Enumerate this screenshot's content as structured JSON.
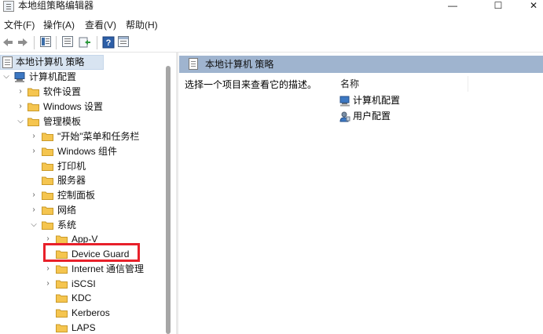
{
  "window": {
    "title": "本地组策略编辑器",
    "minimize_glyph": "—",
    "maximize_glyph": "☐",
    "close_glyph": "✕"
  },
  "menu": {
    "items": [
      "文件(F)",
      "操作(A)",
      "查看(V)",
      "帮助(H)"
    ]
  },
  "toolbar": {
    "buttons": [
      "back-icon",
      "forward-icon",
      "show-hide-tree-icon",
      "properties-icon",
      "export-list-icon",
      "help-icon",
      "console-view-icon"
    ]
  },
  "tree": {
    "root": "本地计算机 策略",
    "computer_config": "计算机配置",
    "software_settings": "软件设置",
    "windows_settings": "Windows 设置",
    "admin_templates": "管理模板",
    "start_menu": "\"开始\"菜单和任务栏",
    "windows_components": "Windows 组件",
    "printers": "打印机",
    "server": "服务器",
    "control_panel": "控制面板",
    "network": "网络",
    "system": "系统",
    "app_v": "App-V",
    "device_guard": "Device Guard",
    "internet_comm": "Internet 通信管理",
    "iscsi": "iSCSI",
    "kdc": "KDC",
    "kerberos": "Kerberos",
    "laps": "LAPS"
  },
  "right_pane": {
    "header_title": "本地计算机 策略",
    "description": "选择一个项目来查看它的描述。",
    "column_name": "名称",
    "items": [
      "计算机配置",
      "用户配置"
    ]
  },
  "highlight": {
    "target": "Device Guard",
    "color": "#e8202a"
  },
  "colors": {
    "pane_header": "#9fb4cf",
    "selection": "#d8e4f1",
    "folder": "#f5c54f"
  }
}
